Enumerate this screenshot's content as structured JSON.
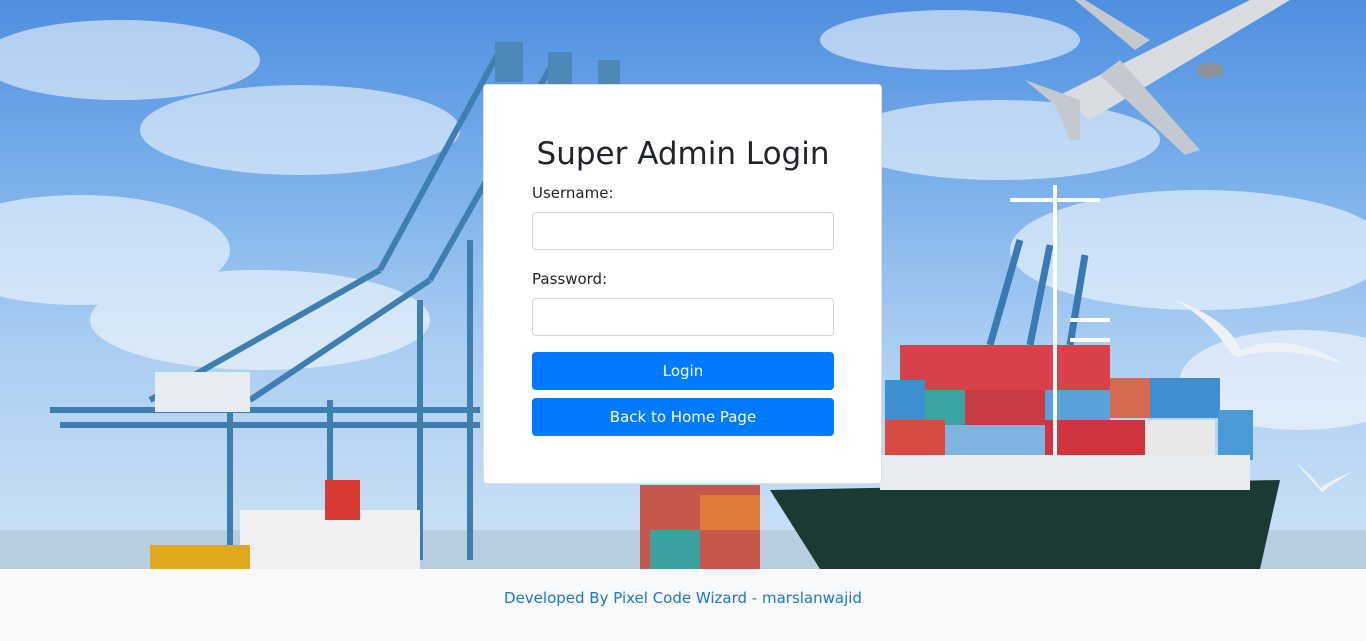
{
  "login": {
    "title": "Super Admin Login",
    "username_label": "Username:",
    "username_value": "",
    "password_label": "Password:",
    "password_value": "",
    "login_button": "Login",
    "back_button": "Back to Home Page"
  },
  "footer": {
    "credit": "Developed By Pixel Code Wizard - marslanwajid"
  },
  "colors": {
    "primary": "#007bff",
    "footer_bg": "#f8f9fa",
    "footer_link": "#1e73d8"
  }
}
